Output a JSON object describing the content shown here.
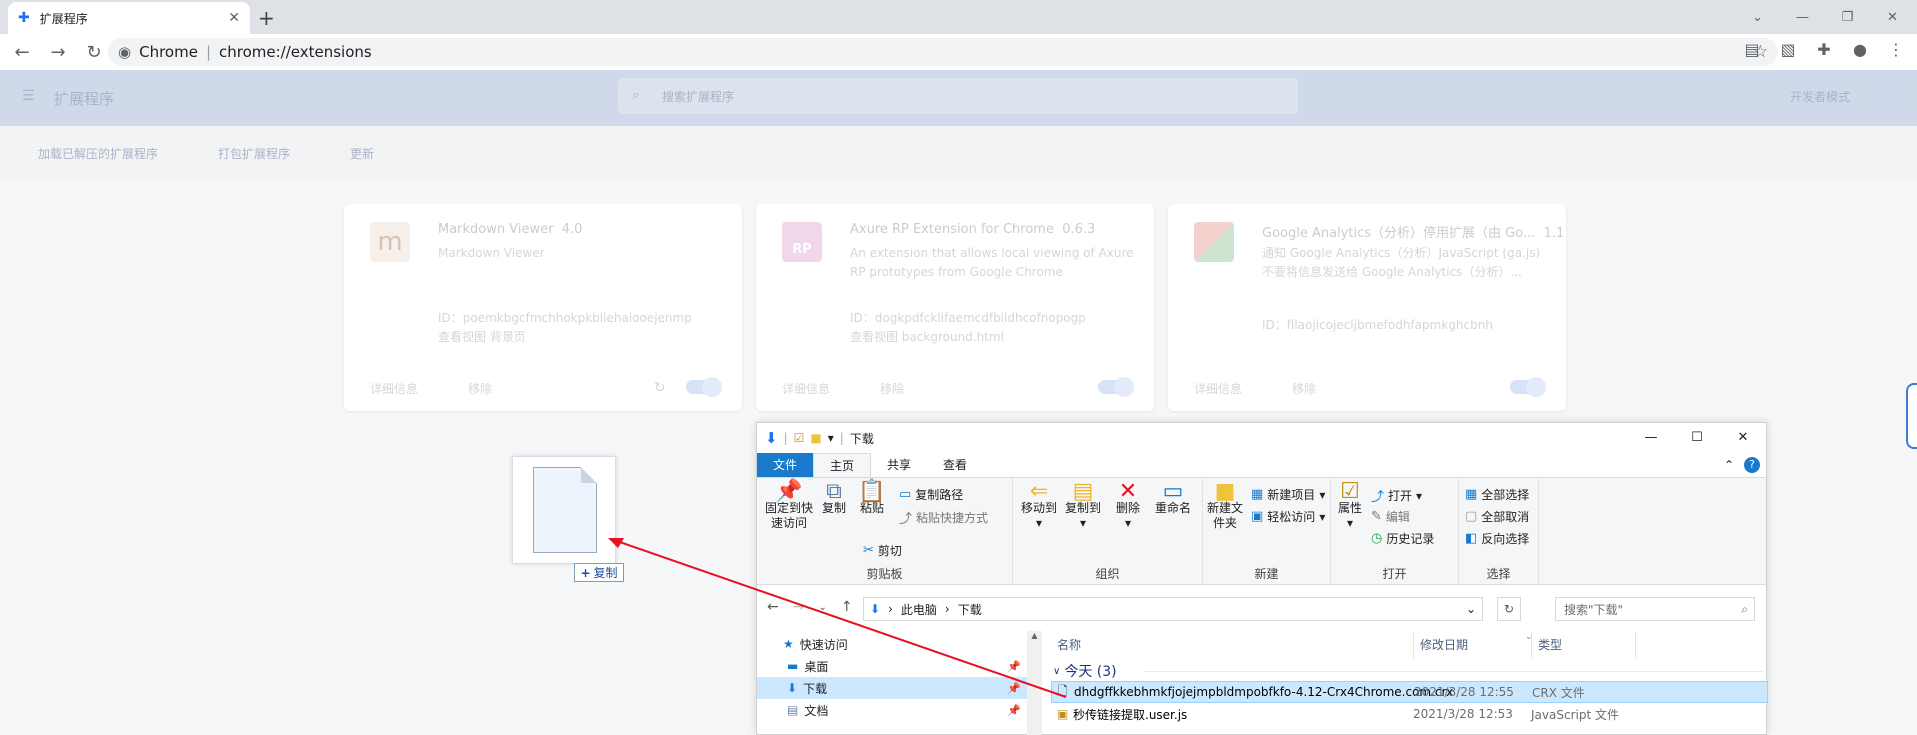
{
  "browser": {
    "tab_title": "扩展程序",
    "tab_icon": "puzzle-icon",
    "url_label": "Chrome",
    "url": "chrome://extensions"
  },
  "extensions_page": {
    "header_title": "扩展程序",
    "search_placeholder": "搜索扩展程序",
    "dev_mode_label": "开发者模式",
    "toolbar": [
      "加载已解压的扩展程序",
      "打包扩展程序",
      "更新"
    ],
    "cards": [
      {
        "name": "Markdown Viewer",
        "version": "4.0",
        "description": "Markdown Viewer",
        "id": "ID：poemkbgcfmchhokpkbllehaiooejenmp",
        "view": "查看视图 背景页",
        "details": "详细信息",
        "remove": "移除"
      },
      {
        "name": "Axure RP Extension for Chrome",
        "version": "0.6.3",
        "description": "An extension that allows local viewing of Axure RP prototypes from Google Chrome",
        "id": "ID：dogkpdfcklifaemcdfbildhcofnopogp",
        "view": "查看视图 background.html",
        "details": "详细信息",
        "remove": "移除"
      },
      {
        "name": "Google Analytics（分析）停用扩展（由 Go...",
        "version": "1.1",
        "description": "通知 Google Analytics（分析）JavaScript (ga.js) 不要将信息发送给 Google Analytics（分析）...",
        "id": "ID：fllaojicojecljbmefodhfapmkghcbnh",
        "view": "",
        "details": "详细信息",
        "remove": "移除"
      }
    ]
  },
  "drag": {
    "copy_label": "复制"
  },
  "explorer": {
    "title": "下载",
    "tabs": [
      "文件",
      "主页",
      "共享",
      "查看"
    ],
    "clipboard": {
      "pin": "固定到快速访问",
      "copy": "复制",
      "paste": "粘贴",
      "copy_path": "复制路径",
      "paste_shortcut": "粘贴快捷方式",
      "cut": "剪切",
      "group": "剪贴板"
    },
    "organize": {
      "move_to": "移动到",
      "copy_to": "复制到",
      "delete": "删除",
      "rename": "重命名",
      "group": "组织"
    },
    "new": {
      "new_folder": "新建文件夹",
      "new_item": "新建项目",
      "easy_access": "轻松访问",
      "group": "新建"
    },
    "open": {
      "properties": "属性",
      "open": "打开",
      "edit": "编辑",
      "history": "历史记录",
      "group": "打开"
    },
    "select": {
      "select_all": "全部选择",
      "select_none": "全部取消",
      "invert": "反向选择",
      "group": "选择"
    },
    "path": [
      "此电脑",
      "下载"
    ],
    "search_placeholder": "搜索\"下载\"",
    "nav": [
      {
        "label": "快速访问",
        "icon": "star-icon"
      },
      {
        "label": "桌面",
        "icon": "desktop-icon"
      },
      {
        "label": "下载",
        "icon": "download-icon"
      },
      {
        "label": "文档",
        "icon": "document-icon"
      }
    ],
    "columns": [
      "名称",
      "修改日期",
      "类型"
    ],
    "group_label": "今天 (3)",
    "files": [
      {
        "name": "dhdgffkkebhmkfjojejmpbldmpobfkfo-4.12-Crx4Chrome.com.crx",
        "date": "2021/3/28 12:55",
        "type": "CRX 文件"
      },
      {
        "name": "秒传链接提取.user.js",
        "date": "2021/3/28 12:53",
        "type": "JavaScript 文件"
      }
    ]
  },
  "colors": {
    "accent": "#1979ca",
    "arrow": "#e81123",
    "selected": "#cce8ff"
  }
}
